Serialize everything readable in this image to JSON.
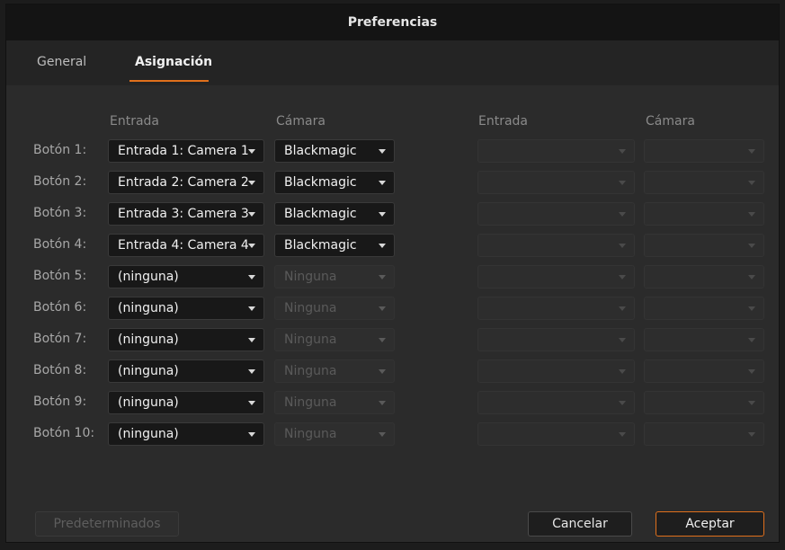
{
  "window": {
    "title": "Preferencias"
  },
  "tabs": [
    {
      "label": "General",
      "active": false
    },
    {
      "label": "Asignación",
      "active": true
    }
  ],
  "columns": {
    "left_input": "Entrada",
    "left_camera": "Cámara",
    "right_input": "Entrada",
    "right_camera": "Cámara"
  },
  "rows": [
    {
      "label": "Botón 1:",
      "input": "Entrada 1: Camera 1",
      "camera": "Blackmagic",
      "camera_enabled": true
    },
    {
      "label": "Botón 2:",
      "input": "Entrada 2: Camera 2",
      "camera": "Blackmagic",
      "camera_enabled": true
    },
    {
      "label": "Botón 3:",
      "input": "Entrada 3: Camera 3",
      "camera": "Blackmagic",
      "camera_enabled": true
    },
    {
      "label": "Botón 4:",
      "input": "Entrada 4: Camera 4",
      "camera": "Blackmagic",
      "camera_enabled": true
    },
    {
      "label": "Botón 5:",
      "input": "(ninguna)",
      "camera": "Ninguna",
      "camera_enabled": false
    },
    {
      "label": "Botón 6:",
      "input": "(ninguna)",
      "camera": "Ninguna",
      "camera_enabled": false
    },
    {
      "label": "Botón 7:",
      "input": "(ninguna)",
      "camera": "Ninguna",
      "camera_enabled": false
    },
    {
      "label": "Botón 8:",
      "input": "(ninguna)",
      "camera": "Ninguna",
      "camera_enabled": false
    },
    {
      "label": "Botón 9:",
      "input": "(ninguna)",
      "camera": "Ninguna",
      "camera_enabled": false
    },
    {
      "label": "Botón 10:",
      "input": "(ninguna)",
      "camera": "Ninguna",
      "camera_enabled": false
    }
  ],
  "footer": {
    "defaults_label": "Predeterminados",
    "cancel_label": "Cancelar",
    "accept_label": "Aceptar"
  },
  "colors": {
    "accent": "#e0701c",
    "window_bg": "#2b2b2b",
    "titlebar_bg": "#141414"
  },
  "icons": {
    "dropdown": "chevron-down-icon"
  }
}
